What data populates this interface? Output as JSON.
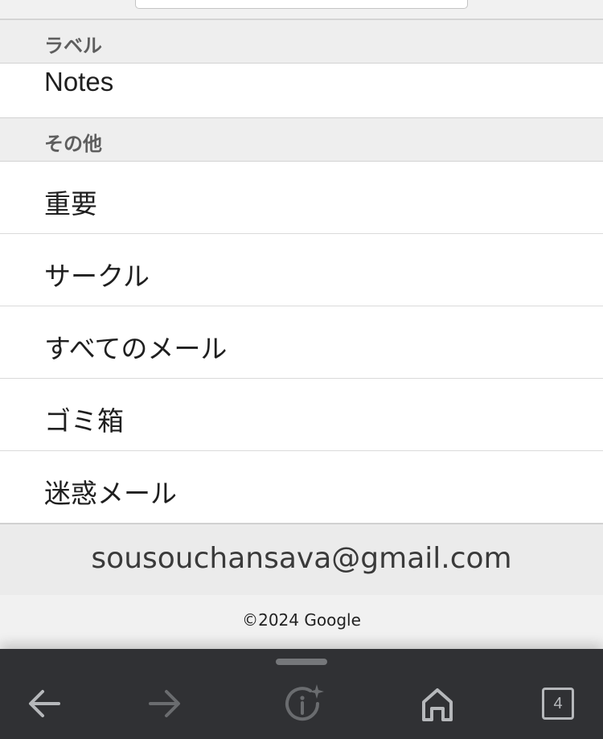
{
  "sections": {
    "labels_header": "ラベル",
    "other_header": "その他"
  },
  "labels": [
    {
      "label": "Notes"
    }
  ],
  "other_items": [
    {
      "label": "重要"
    },
    {
      "label": "サークル"
    },
    {
      "label": "すべてのメール"
    },
    {
      "label": "ゴミ箱"
    },
    {
      "label": "迷惑メール"
    }
  ],
  "account": {
    "email": "sousouchansava@gmail.com"
  },
  "footer": {
    "copyright": "©2024 Google"
  },
  "browser_toolbar": {
    "back_icon": "arrow-left-icon",
    "forward_icon": "arrow-right-icon",
    "page_info_icon": "sparkle-info-icon",
    "home_icon": "home-icon",
    "tab_count": "4"
  },
  "colors": {
    "toolbar_bg": "#303134",
    "section_header_bg": "#eeeeee",
    "row_bg": "#ffffff"
  }
}
